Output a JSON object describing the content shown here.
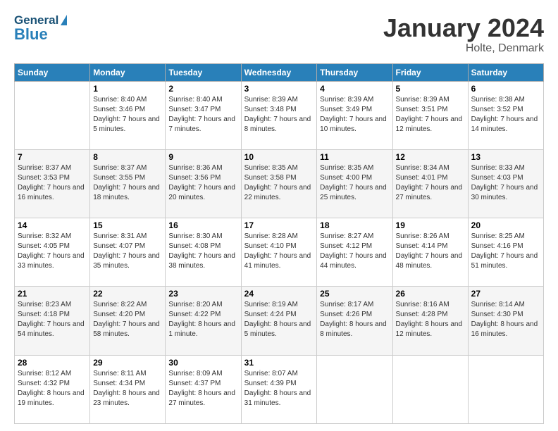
{
  "header": {
    "logo_general": "General",
    "logo_blue": "Blue",
    "month_title": "January 2024",
    "location": "Holte, Denmark"
  },
  "weekdays": [
    "Sunday",
    "Monday",
    "Tuesday",
    "Wednesday",
    "Thursday",
    "Friday",
    "Saturday"
  ],
  "weeks": [
    [
      {
        "day": "",
        "sunrise": "",
        "sunset": "",
        "daylight": ""
      },
      {
        "day": "1",
        "sunrise": "Sunrise: 8:40 AM",
        "sunset": "Sunset: 3:46 PM",
        "daylight": "Daylight: 7 hours and 5 minutes."
      },
      {
        "day": "2",
        "sunrise": "Sunrise: 8:40 AM",
        "sunset": "Sunset: 3:47 PM",
        "daylight": "Daylight: 7 hours and 7 minutes."
      },
      {
        "day": "3",
        "sunrise": "Sunrise: 8:39 AM",
        "sunset": "Sunset: 3:48 PM",
        "daylight": "Daylight: 7 hours and 8 minutes."
      },
      {
        "day": "4",
        "sunrise": "Sunrise: 8:39 AM",
        "sunset": "Sunset: 3:49 PM",
        "daylight": "Daylight: 7 hours and 10 minutes."
      },
      {
        "day": "5",
        "sunrise": "Sunrise: 8:39 AM",
        "sunset": "Sunset: 3:51 PM",
        "daylight": "Daylight: 7 hours and 12 minutes."
      },
      {
        "day": "6",
        "sunrise": "Sunrise: 8:38 AM",
        "sunset": "Sunset: 3:52 PM",
        "daylight": "Daylight: 7 hours and 14 minutes."
      }
    ],
    [
      {
        "day": "7",
        "sunrise": "Sunrise: 8:37 AM",
        "sunset": "Sunset: 3:53 PM",
        "daylight": "Daylight: 7 hours and 16 minutes."
      },
      {
        "day": "8",
        "sunrise": "Sunrise: 8:37 AM",
        "sunset": "Sunset: 3:55 PM",
        "daylight": "Daylight: 7 hours and 18 minutes."
      },
      {
        "day": "9",
        "sunrise": "Sunrise: 8:36 AM",
        "sunset": "Sunset: 3:56 PM",
        "daylight": "Daylight: 7 hours and 20 minutes."
      },
      {
        "day": "10",
        "sunrise": "Sunrise: 8:35 AM",
        "sunset": "Sunset: 3:58 PM",
        "daylight": "Daylight: 7 hours and 22 minutes."
      },
      {
        "day": "11",
        "sunrise": "Sunrise: 8:35 AM",
        "sunset": "Sunset: 4:00 PM",
        "daylight": "Daylight: 7 hours and 25 minutes."
      },
      {
        "day": "12",
        "sunrise": "Sunrise: 8:34 AM",
        "sunset": "Sunset: 4:01 PM",
        "daylight": "Daylight: 7 hours and 27 minutes."
      },
      {
        "day": "13",
        "sunrise": "Sunrise: 8:33 AM",
        "sunset": "Sunset: 4:03 PM",
        "daylight": "Daylight: 7 hours and 30 minutes."
      }
    ],
    [
      {
        "day": "14",
        "sunrise": "Sunrise: 8:32 AM",
        "sunset": "Sunset: 4:05 PM",
        "daylight": "Daylight: 7 hours and 33 minutes."
      },
      {
        "day": "15",
        "sunrise": "Sunrise: 8:31 AM",
        "sunset": "Sunset: 4:07 PM",
        "daylight": "Daylight: 7 hours and 35 minutes."
      },
      {
        "day": "16",
        "sunrise": "Sunrise: 8:30 AM",
        "sunset": "Sunset: 4:08 PM",
        "daylight": "Daylight: 7 hours and 38 minutes."
      },
      {
        "day": "17",
        "sunrise": "Sunrise: 8:28 AM",
        "sunset": "Sunset: 4:10 PM",
        "daylight": "Daylight: 7 hours and 41 minutes."
      },
      {
        "day": "18",
        "sunrise": "Sunrise: 8:27 AM",
        "sunset": "Sunset: 4:12 PM",
        "daylight": "Daylight: 7 hours and 44 minutes."
      },
      {
        "day": "19",
        "sunrise": "Sunrise: 8:26 AM",
        "sunset": "Sunset: 4:14 PM",
        "daylight": "Daylight: 7 hours and 48 minutes."
      },
      {
        "day": "20",
        "sunrise": "Sunrise: 8:25 AM",
        "sunset": "Sunset: 4:16 PM",
        "daylight": "Daylight: 7 hours and 51 minutes."
      }
    ],
    [
      {
        "day": "21",
        "sunrise": "Sunrise: 8:23 AM",
        "sunset": "Sunset: 4:18 PM",
        "daylight": "Daylight: 7 hours and 54 minutes."
      },
      {
        "day": "22",
        "sunrise": "Sunrise: 8:22 AM",
        "sunset": "Sunset: 4:20 PM",
        "daylight": "Daylight: 7 hours and 58 minutes."
      },
      {
        "day": "23",
        "sunrise": "Sunrise: 8:20 AM",
        "sunset": "Sunset: 4:22 PM",
        "daylight": "Daylight: 8 hours and 1 minute."
      },
      {
        "day": "24",
        "sunrise": "Sunrise: 8:19 AM",
        "sunset": "Sunset: 4:24 PM",
        "daylight": "Daylight: 8 hours and 5 minutes."
      },
      {
        "day": "25",
        "sunrise": "Sunrise: 8:17 AM",
        "sunset": "Sunset: 4:26 PM",
        "daylight": "Daylight: 8 hours and 8 minutes."
      },
      {
        "day": "26",
        "sunrise": "Sunrise: 8:16 AM",
        "sunset": "Sunset: 4:28 PM",
        "daylight": "Daylight: 8 hours and 12 minutes."
      },
      {
        "day": "27",
        "sunrise": "Sunrise: 8:14 AM",
        "sunset": "Sunset: 4:30 PM",
        "daylight": "Daylight: 8 hours and 16 minutes."
      }
    ],
    [
      {
        "day": "28",
        "sunrise": "Sunrise: 8:12 AM",
        "sunset": "Sunset: 4:32 PM",
        "daylight": "Daylight: 8 hours and 19 minutes."
      },
      {
        "day": "29",
        "sunrise": "Sunrise: 8:11 AM",
        "sunset": "Sunset: 4:34 PM",
        "daylight": "Daylight: 8 hours and 23 minutes."
      },
      {
        "day": "30",
        "sunrise": "Sunrise: 8:09 AM",
        "sunset": "Sunset: 4:37 PM",
        "daylight": "Daylight: 8 hours and 27 minutes."
      },
      {
        "day": "31",
        "sunrise": "Sunrise: 8:07 AM",
        "sunset": "Sunset: 4:39 PM",
        "daylight": "Daylight: 8 hours and 31 minutes."
      },
      {
        "day": "",
        "sunrise": "",
        "sunset": "",
        "daylight": ""
      },
      {
        "day": "",
        "sunrise": "",
        "sunset": "",
        "daylight": ""
      },
      {
        "day": "",
        "sunrise": "",
        "sunset": "",
        "daylight": ""
      }
    ]
  ]
}
